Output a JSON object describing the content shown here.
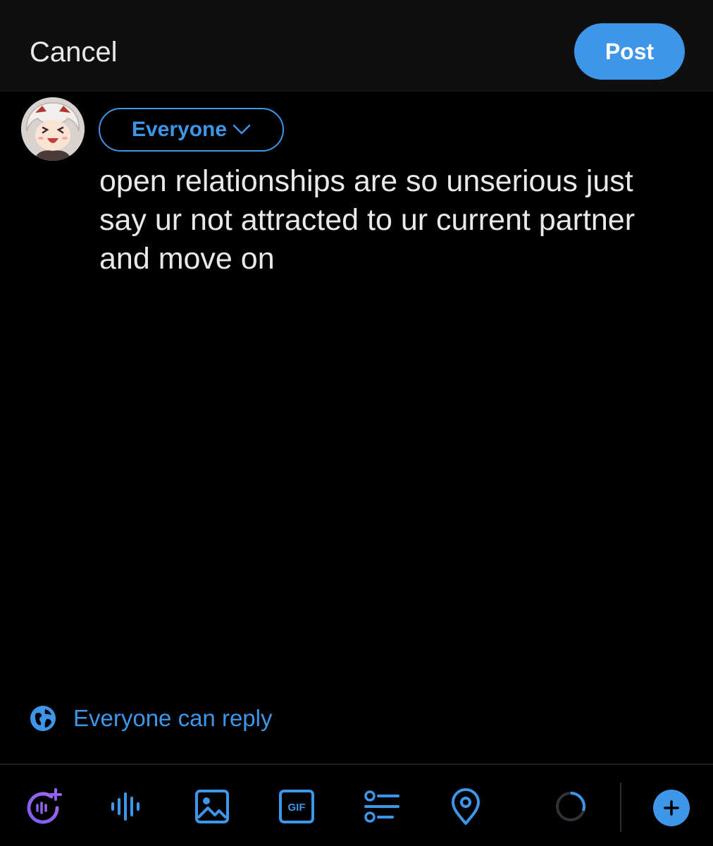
{
  "header": {
    "cancel_label": "Cancel",
    "post_label": "Post"
  },
  "composer": {
    "audience_label": "Everyone",
    "text": "open relationships are so unserious just\nsay ur not attracted to ur current partner\nand move on"
  },
  "reply_setting": {
    "label": "Everyone can reply",
    "icon": "globe-icon"
  },
  "toolbar": {
    "icons": [
      "grok-icon",
      "voice-icon",
      "image-icon",
      "gif-icon",
      "poll-icon",
      "location-icon",
      "char-progress-icon",
      "add-post-icon"
    ],
    "gif_text": "GIF"
  },
  "colors": {
    "accent": "#3d96e8",
    "background": "#000000",
    "header_background": "#0f0f10",
    "text": "#e7e9ea"
  }
}
